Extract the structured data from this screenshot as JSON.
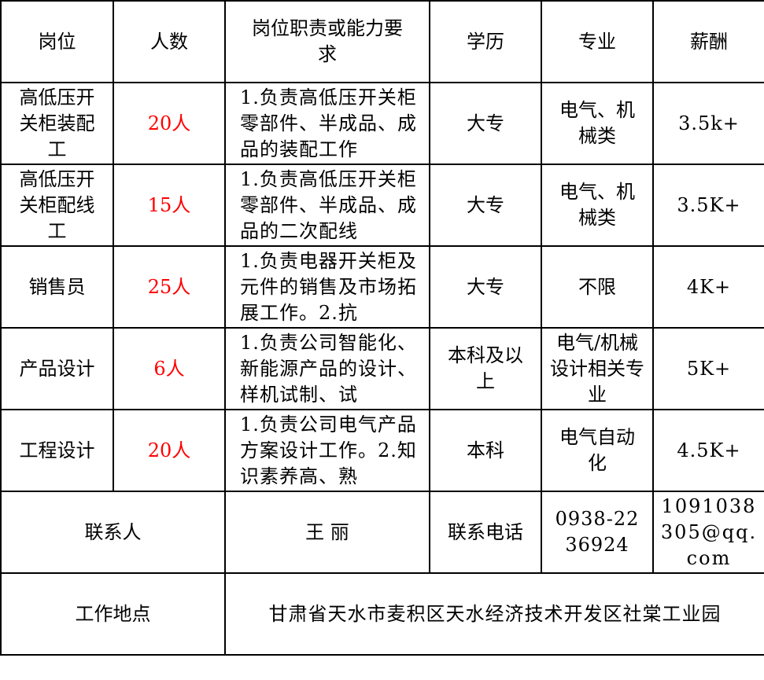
{
  "table": {
    "headers": [
      "岗位",
      "人数",
      "岗位职责或能力要求",
      "学历",
      "专业",
      "薪酬"
    ],
    "rows": [
      {
        "position": "高低压开关柜装配工",
        "count": "20人",
        "description": "1.负责高低压开关柜零部件、半成品、成品的装配工作",
        "education": "大专",
        "major": "电气、机械类",
        "salary": "3.5k+"
      },
      {
        "position": "高低压开关柜配线工",
        "count": "15人",
        "description": "1.负责高低压开关柜零部件、半成品、成品的二次配线",
        "education": "大专",
        "major": "电气、机械类",
        "salary": "3.5K+"
      },
      {
        "position": "销售员",
        "count": "25人",
        "description": "1.负责电器开关柜及元件的销售及市场拓展工作。2.抗",
        "education": "大专",
        "major": "不限",
        "salary": "4K+"
      },
      {
        "position": "产品设计",
        "count": "6人",
        "description": "1.负责公司智能化、新能源产品的设计、样机试制、试",
        "education": "本科及以上",
        "major": "电气/机械设计相关专业",
        "salary": "5K+"
      },
      {
        "position": "工程设计",
        "count": "20人",
        "description": "1.负责公司电气产品方案设计工作。2.知识素养高、熟",
        "education": "本科",
        "major": "电气自动化",
        "salary": "4.5K+"
      }
    ],
    "contact": {
      "label": "联系人",
      "name": "王 丽",
      "phone_label": "联系电话",
      "phone": "0938-2236924",
      "email": "1091038305@qq.com"
    },
    "location": {
      "label": "工作地点",
      "address": "甘肃省天水市麦积区天水经济技术开发区社棠工业园"
    }
  },
  "colors": {
    "count_text": "#ff0000",
    "text": "#000000",
    "border": "#000000"
  }
}
